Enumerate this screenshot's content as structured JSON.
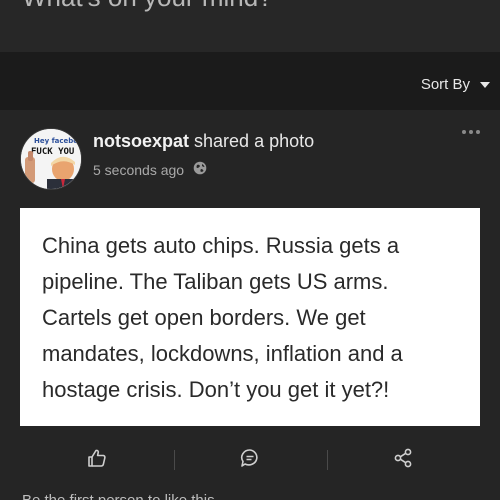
{
  "composer": {
    "prompt": "What's on your mind?"
  },
  "sort": {
    "label": "Sort By"
  },
  "post": {
    "author": "notsoexpat",
    "action": "shared a photo",
    "time": "5 seconds ago",
    "avatar_text": [
      "Hey facebo",
      "FUCK YOU"
    ],
    "image_lines": [
      "China gets auto chips. Russia gets a",
      "pipeline. The Taliban gets US arms.",
      "Cartels get open borders. We get",
      "mandates, lockdowns, inflation and a",
      "hostage crisis. Don’t you get it yet?!"
    ],
    "footer": "Be the first person to like this"
  },
  "icons": {
    "more": "more-horizontal-icon",
    "privacy": "globe-icon",
    "like": "thumbs-up-icon",
    "comment": "comment-icon",
    "share": "share-icon"
  }
}
